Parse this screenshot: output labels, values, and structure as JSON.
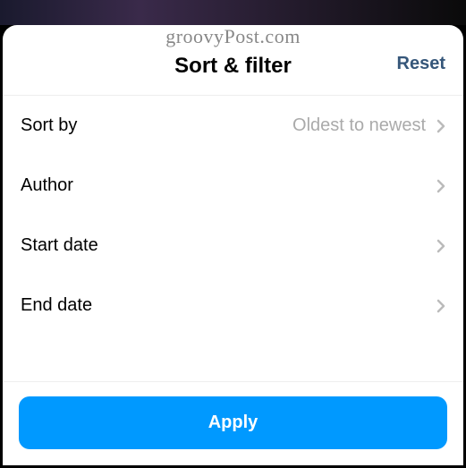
{
  "watermark": "groovyPost.com",
  "header": {
    "title": "Sort & filter",
    "reset_label": "Reset"
  },
  "options": {
    "sort_by": {
      "label": "Sort by",
      "value": "Oldest to newest"
    },
    "author": {
      "label": "Author"
    },
    "start_date": {
      "label": "Start date"
    },
    "end_date": {
      "label": "End date"
    }
  },
  "footer": {
    "apply_label": "Apply"
  }
}
